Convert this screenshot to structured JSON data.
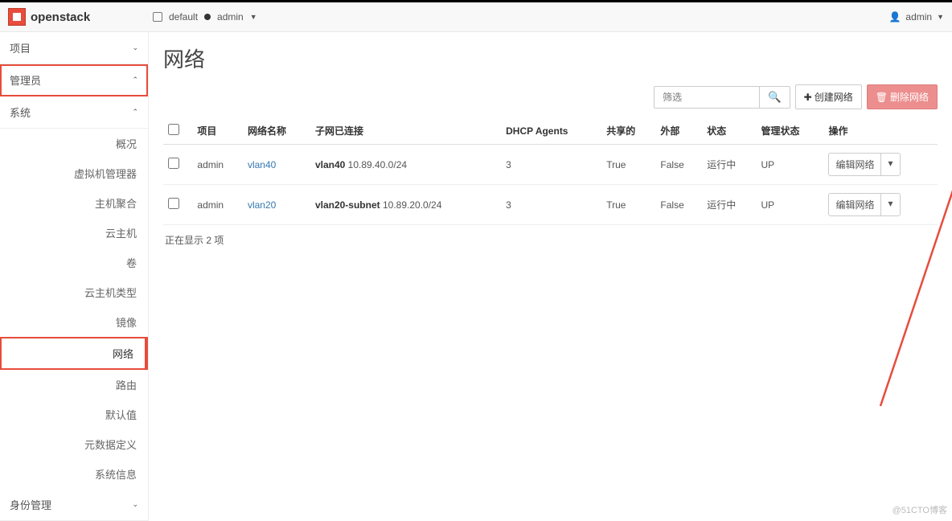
{
  "header": {
    "brand": "openstack",
    "domain_label": "default",
    "project_label": "admin",
    "user_label": "admin"
  },
  "sidebar": {
    "groups": {
      "project": "项目",
      "admin": "管理员",
      "system": "系统",
      "identity": "身份管理"
    },
    "items": [
      "概况",
      "虚拟机管理器",
      "主机聚合",
      "云主机",
      "卷",
      "云主机类型",
      "镜像",
      "网络",
      "路由",
      "默认值",
      "元数据定义",
      "系统信息"
    ]
  },
  "page": {
    "title": "网络",
    "filter_placeholder": "筛选",
    "create_label": "创建网络",
    "delete_label": "删除网络",
    "footer": "正在显示 2 项",
    "watermark": "@51CTO博客"
  },
  "table": {
    "headers": [
      "项目",
      "网络名称",
      "子网已连接",
      "DHCP Agents",
      "共享的",
      "外部",
      "状态",
      "管理状态",
      "操作"
    ],
    "rows": [
      {
        "project": "admin",
        "name": "vlan40",
        "subnet_name": "vlan40",
        "subnet_cidr": "10.89.40.0/24",
        "dhcp": "3",
        "shared": "True",
        "external": "False",
        "status": "运行中",
        "admin_state": "UP",
        "op": "编辑网络"
      },
      {
        "project": "admin",
        "name": "vlan20",
        "subnet_name": "vlan20-subnet",
        "subnet_cidr": "10.89.20.0/24",
        "dhcp": "3",
        "shared": "True",
        "external": "False",
        "status": "运行中",
        "admin_state": "UP",
        "op": "编辑网络"
      }
    ]
  }
}
